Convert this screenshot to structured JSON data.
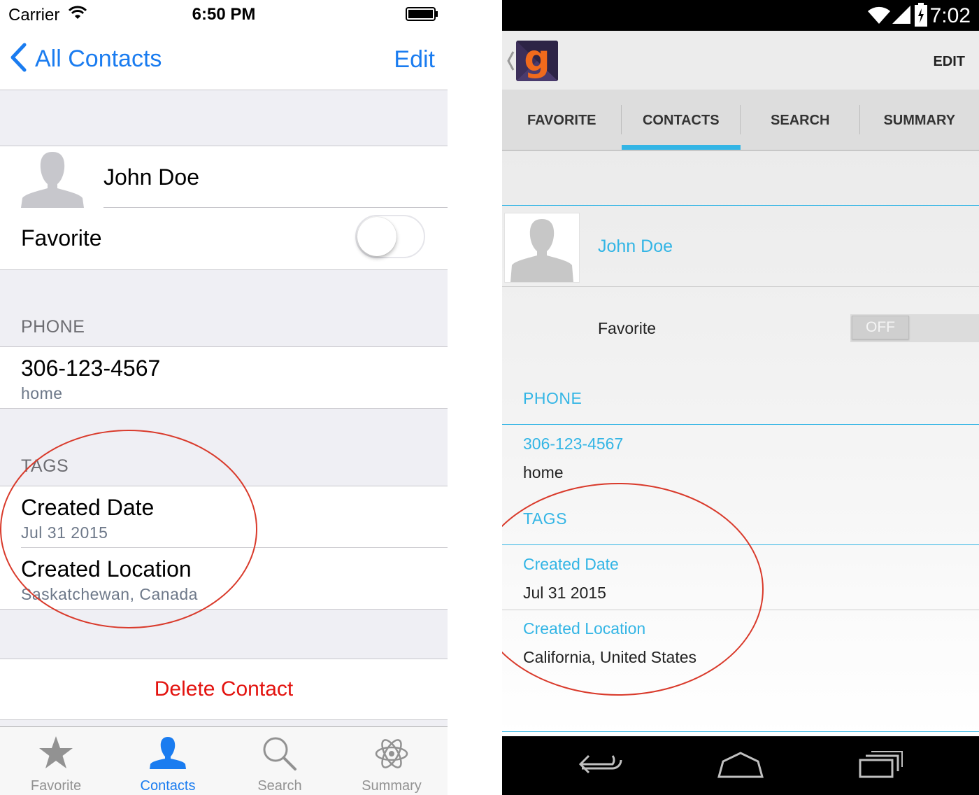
{
  "ios": {
    "status": {
      "carrier": "Carrier",
      "time": "6:50 PM"
    },
    "nav": {
      "back_label": "All Contacts",
      "edit_label": "Edit"
    },
    "contact": {
      "name": "John Doe",
      "favorite_label": "Favorite",
      "favorite_on": false
    },
    "phone": {
      "header": "PHONE",
      "number": "306-123-4567",
      "type": "home"
    },
    "tags": {
      "header": "TAGS",
      "items": [
        {
          "label": "Created Date",
          "value": "Jul 31 2015"
        },
        {
          "label": "Created Location",
          "value": "Saskatchewan, Canada"
        }
      ]
    },
    "delete_label": "Delete Contact",
    "tabs": [
      {
        "label": "Favorite",
        "icon": "star-icon",
        "active": false
      },
      {
        "label": "Contacts",
        "icon": "person-icon",
        "active": true
      },
      {
        "label": "Search",
        "icon": "magnifier-icon",
        "active": false
      },
      {
        "label": "Summary",
        "icon": "atom-icon",
        "active": false
      }
    ],
    "colors": {
      "accent": "#1a7cf0",
      "destructive": "#e3130f"
    }
  },
  "android": {
    "status": {
      "time": "7:02"
    },
    "actionbar": {
      "logo_letter": "g",
      "edit_label": "EDIT"
    },
    "tabs": [
      {
        "label": "FAVORITE",
        "active": false
      },
      {
        "label": "CONTACTS",
        "active": true
      },
      {
        "label": "SEARCH",
        "active": false
      },
      {
        "label": "SUMMARY",
        "active": false
      }
    ],
    "contact": {
      "name": "John Doe",
      "favorite_label": "Favorite",
      "switch_label": "OFF"
    },
    "phone": {
      "header": "PHONE",
      "number": "306-123-4567",
      "type": "home"
    },
    "tags": {
      "header": "TAGS",
      "items": [
        {
          "label": "Created Date",
          "value": "Jul 31 2015"
        },
        {
          "label": "Created Location",
          "value": "California, United States"
        }
      ]
    },
    "colors": {
      "accent": "#33b5e5"
    }
  },
  "annotation_color": "#d93a2b"
}
